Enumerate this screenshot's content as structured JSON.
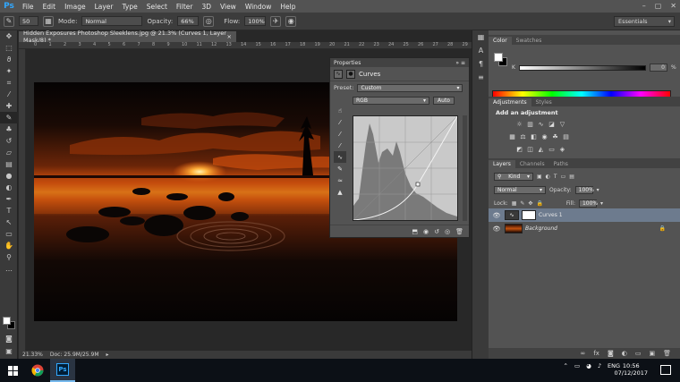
{
  "app": {
    "logo": "Ps",
    "menu": [
      "File",
      "Edit",
      "Image",
      "Layer",
      "Type",
      "Select",
      "Filter",
      "3D",
      "View",
      "Window",
      "Help"
    ],
    "window_controls": [
      "–",
      "▢",
      "✕"
    ]
  },
  "options_bar": {
    "brush_size": "50",
    "mode_label": "Mode:",
    "mode_value": "Normal",
    "opacity_label": "Opacity:",
    "opacity_value": "66%",
    "flow_label": "Flow:",
    "flow_value": "100%",
    "workspace": "Essentials"
  },
  "document": {
    "tab_title": "Hidden Exposures Photoshop Sleeklens.jpg @ 21.3% (Curves 1, Layer Mask/8) *",
    "tab_close": "×",
    "ruler_ticks": [
      "0",
      "1",
      "2",
      "3",
      "4",
      "5",
      "6",
      "7",
      "8",
      "9",
      "10",
      "11",
      "12",
      "13",
      "14",
      "15",
      "16",
      "17",
      "18",
      "19",
      "20",
      "21",
      "22",
      "23",
      "24",
      "25",
      "26",
      "27",
      "28",
      "29",
      "30"
    ],
    "zoom": "21.33%",
    "doc_size": "Doc: 25.9M/25.9M"
  },
  "properties": {
    "header": "Properties",
    "title": "Curves",
    "preset_label": "Preset:",
    "preset_value": "Custom",
    "channel_value": "RGB",
    "auto_label": "Auto"
  },
  "color_panel": {
    "tabs": [
      "Color",
      "Swatches"
    ],
    "k_label": "K",
    "k_value": "0",
    "k_unit": "%"
  },
  "adjustments_panel": {
    "tabs": [
      "Adjustments",
      "Styles"
    ],
    "title": "Add an adjustment"
  },
  "layers_panel": {
    "tabs": [
      "Layers",
      "Channels",
      "Paths"
    ],
    "kind_value": "Kind",
    "blend_value": "Normal",
    "opacity_label": "Opacity:",
    "opacity_value": "100%",
    "lock_label": "Lock:",
    "fill_label": "Fill:",
    "fill_value": "100%",
    "layers": [
      {
        "name": "Curves 1",
        "selected": true
      },
      {
        "name": "Background",
        "selected": false
      }
    ]
  },
  "taskbar": {
    "language": "ENG",
    "time": "10:56",
    "date": "07/12/2017"
  },
  "colors": {
    "accent": "#31a8ff",
    "selected_layer": "#6d7b8e",
    "panel_bg": "#535353"
  }
}
